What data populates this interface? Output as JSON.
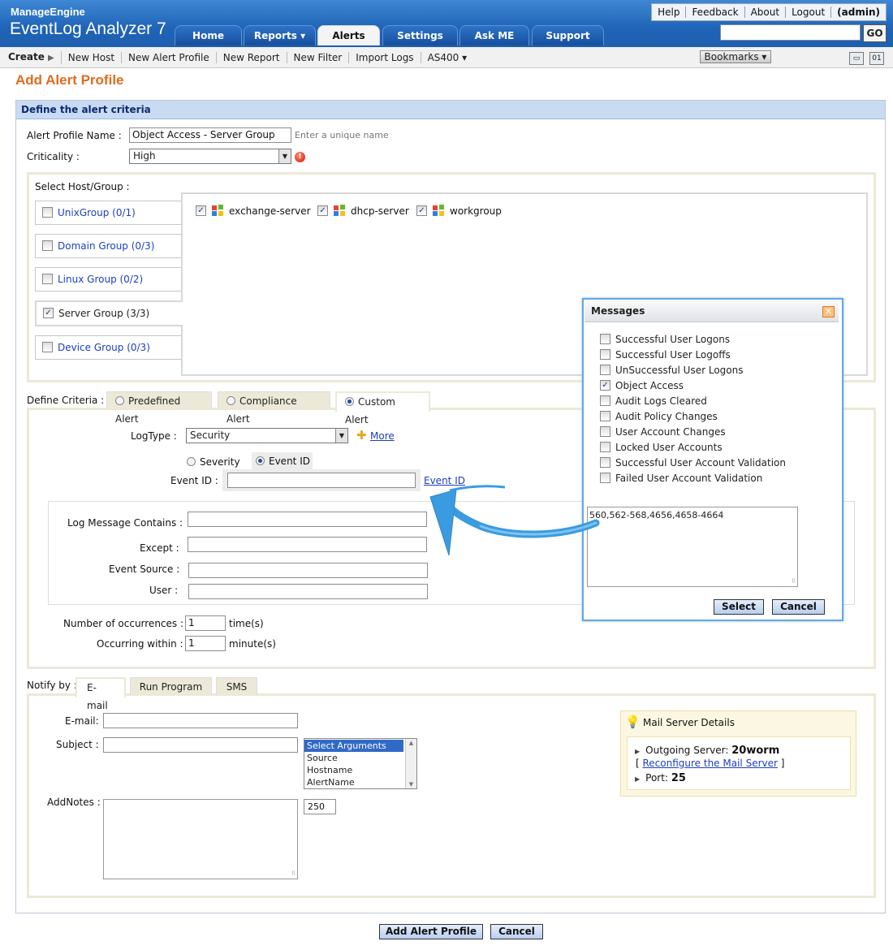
{
  "header": {
    "brand_line1": "ManageEngine",
    "brand_line2": "EventLog Analyzer 7",
    "top_links": [
      "Help",
      "Feedback",
      "About",
      "Logout",
      "(admin)"
    ],
    "tabs": [
      {
        "label": "Home"
      },
      {
        "label": "Reports ▾"
      },
      {
        "label": "Alerts"
      },
      {
        "label": "Settings"
      },
      {
        "label": "Ask ME"
      },
      {
        "label": "Support"
      }
    ],
    "active_tab": "Alerts",
    "search_value": "",
    "go_label": "GO"
  },
  "toolbar": {
    "create_label": "Create",
    "items": [
      "New Host",
      "New Alert Profile",
      "New Report",
      "New Filter",
      "Import Logs",
      "AS400 ▾"
    ],
    "bookmarks_label": "Bookmarks ▾"
  },
  "page": {
    "title": "Add Alert Profile",
    "section_title": "Define the alert criteria"
  },
  "form": {
    "profile_name_label": "Alert Profile Name :",
    "profile_name_value": "Object Access - Server Group",
    "profile_name_hint": "Enter a unique name",
    "criticality_label": "Criticality :",
    "criticality_value": "High",
    "host_group_label": "Select Host/Group :",
    "groups": [
      {
        "label": "UnixGroup (0/1)",
        "checked": false,
        "link": true
      },
      {
        "label": "Domain Group (0/3)",
        "checked": false,
        "link": true
      },
      {
        "label": "Linux Group (0/2)",
        "checked": false,
        "link": true
      },
      {
        "label": "Server Group (3/3)",
        "checked": true,
        "link": false
      },
      {
        "label": "Device Group (0/3)",
        "checked": false,
        "link": true
      }
    ],
    "hosts": [
      {
        "name": "exchange-server",
        "checked": true
      },
      {
        "name": "dhcp-server",
        "checked": true
      },
      {
        "name": "workgroup",
        "checked": true
      }
    ],
    "define_criteria_label": "Define Criteria :",
    "criteria_tabs": [
      "Predefined Alert",
      "Compliance Alert",
      "Custom Alert"
    ],
    "criteria_selected": "Custom Alert",
    "logtype_label": "LogType :",
    "logtype_value": "Security",
    "more_label": "More",
    "severity_label": "Severity",
    "eventid_radio_label": "Event ID",
    "eventid_label": "Event ID :",
    "eventid_value": "",
    "eventid_link": "Event ID",
    "log_message_label": "Log Message Contains :",
    "except_label": "Except :",
    "event_source_label": "Event Source :",
    "user_label": "User :",
    "occurrences_label": "Number of occurrences :",
    "occurrences_value": "1",
    "occurrences_unit": "time(s)",
    "within_label": "Occurring within :",
    "within_value": "1",
    "within_unit": "minute(s)"
  },
  "notify": {
    "label": "Notify by :",
    "tabs": [
      "E-mail",
      "Run Program",
      "SMS"
    ],
    "active_tab": "E-mail",
    "email_label": "E-mail:",
    "subject_label": "Subject :",
    "addnotes_label": "AddNotes :",
    "arguments": [
      "Select Arguments",
      "Source",
      "Hostname",
      "AlertName"
    ],
    "char_limit": "250",
    "mail_server": {
      "title": "Mail Server Details",
      "outgoing_label": "Outgoing Server:",
      "outgoing_value": "20worm",
      "reconfigure_link": "Reconfigure the Mail Server",
      "port_label": "Port:",
      "port_value": "25"
    }
  },
  "dialog": {
    "title": "Messages",
    "options": [
      {
        "label": "Successful User Logons",
        "checked": false
      },
      {
        "label": "Successful User Logoffs",
        "checked": false
      },
      {
        "label": "UnSuccessful User Logons",
        "checked": false
      },
      {
        "label": "Object Access",
        "checked": true
      },
      {
        "label": "Audit Logs Cleared",
        "checked": false
      },
      {
        "label": "Audit Policy Changes",
        "checked": false
      },
      {
        "label": "User Account Changes",
        "checked": false
      },
      {
        "label": "Locked User Accounts",
        "checked": false
      },
      {
        "label": "Successful User Account Validation",
        "checked": false
      },
      {
        "label": "Failed User Account Validation",
        "checked": false
      }
    ],
    "ids_value": "560,562-568,4656,4658-4664",
    "select_label": "Select",
    "cancel_label": "Cancel"
  },
  "footer": {
    "add_label": "Add Alert Profile",
    "cancel_label": "Cancel"
  },
  "colors": {
    "header_blue": "#1f64b7",
    "title_orange": "#e06b1f",
    "section_bar": "#c9dbf3",
    "arrow_blue": "#3a9be0",
    "panel_beige": "#ece9d8"
  }
}
